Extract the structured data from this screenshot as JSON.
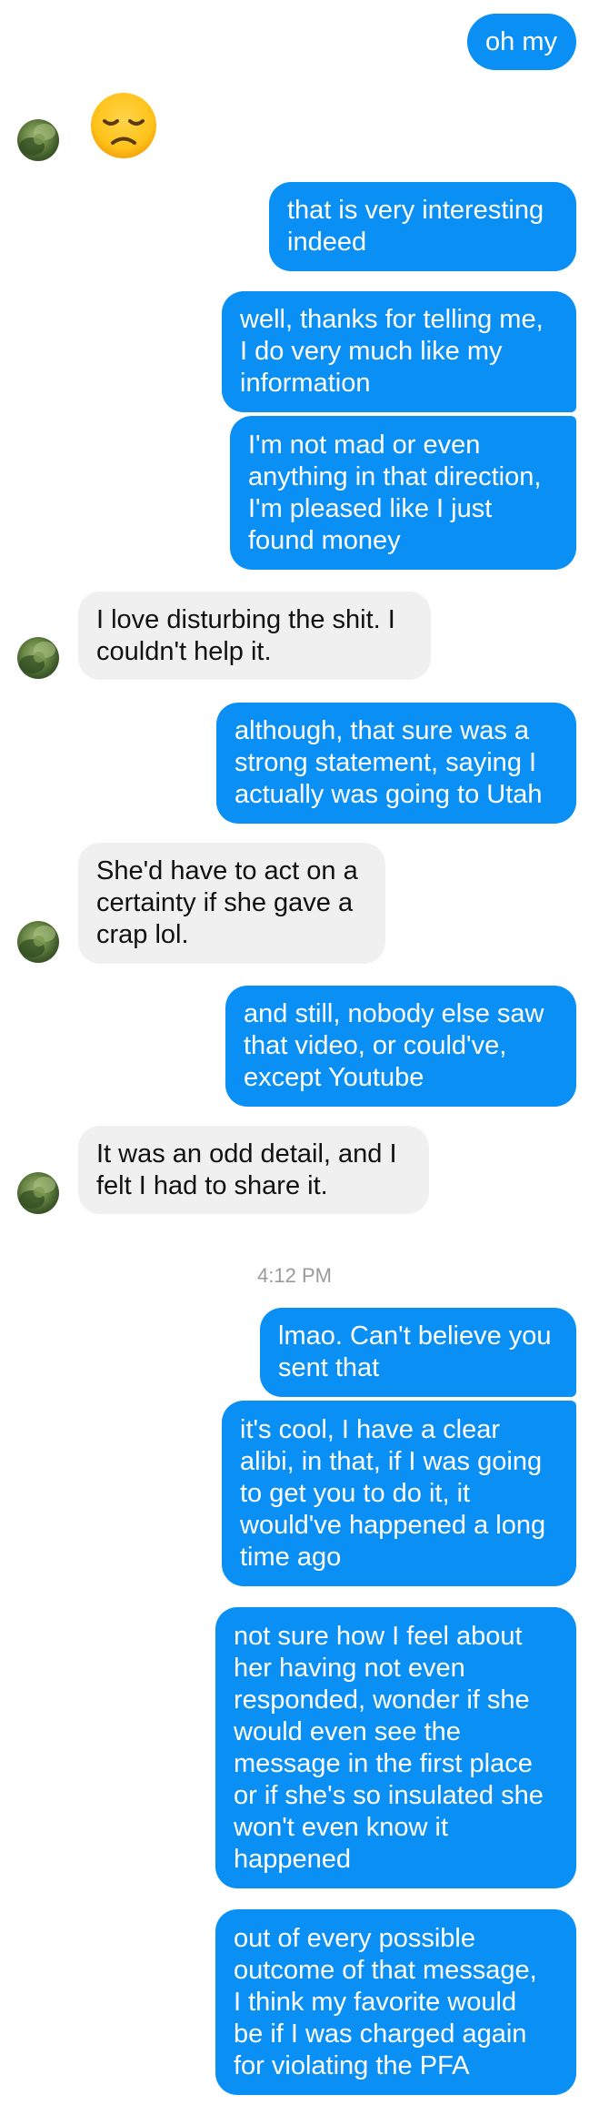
{
  "thread": {
    "messages": [
      {
        "id": 1,
        "sender": "me",
        "text": "oh my"
      },
      {
        "id": 2,
        "sender": "them",
        "emoji_icon": "disappointed-face-emoji"
      },
      {
        "id": 3,
        "sender": "me",
        "text": "that is very interesting\nindeed"
      },
      {
        "id": 4,
        "sender": "me",
        "text": "well, thanks for telling me,\nI do very much like my\ninformation"
      },
      {
        "id": 5,
        "sender": "me",
        "text": "I'm not mad or even\nanything in that direction,\nI'm pleased like I just\nfound money"
      },
      {
        "id": 6,
        "sender": "them",
        "text": "I love disturbing the shit. I\ncouldn't help it."
      },
      {
        "id": 7,
        "sender": "me",
        "text": "although, that sure was a\nstrong statement, saying I\nactually was going to Utah"
      },
      {
        "id": 8,
        "sender": "them",
        "text": "She'd have to act on a\ncertainty if she gave a\ncrap lol."
      },
      {
        "id": 9,
        "sender": "me",
        "text": "and still, nobody else saw\nthat video, or could've,\nexcept Youtube"
      },
      {
        "id": 10,
        "sender": "them",
        "text": "It was an odd detail, and I\nfelt I had to share it."
      },
      {
        "id": 11,
        "sender": "me",
        "text": "lmao. Can't believe you\nsent that"
      },
      {
        "id": 12,
        "sender": "me",
        "text": "it's cool, I have a clear\nalibi, in that, if I was going\nto get you to do it, it\nwould've happened a long\ntime ago"
      },
      {
        "id": 13,
        "sender": "me",
        "text": "not sure how I feel about\nher having not even\nresponded, wonder if she\nwould even see the\nmessage in the first place\nor if she's so insulated she\nwon't even know it\nhappened"
      },
      {
        "id": 14,
        "sender": "me",
        "text": "out of every possible\noutcome of that message,\nI think my favorite would\nbe if I was charged again\nfor violating the PFA"
      }
    ],
    "timestamp": "4:12 PM"
  },
  "colors": {
    "sent_bubble": "#0a8ff5",
    "received_bubble": "#f1f0f0",
    "timestamp_text": "#9a9a9a"
  }
}
